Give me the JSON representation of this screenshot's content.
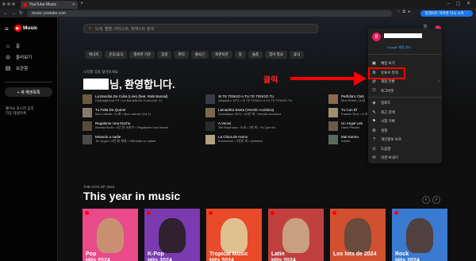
{
  "browser": {
    "tab_title": "YouTube Music",
    "url": "music.youtube.com",
    "update_label": "업데이트 하려면 다시 시작 ⋮",
    "new_tab": "+"
  },
  "app": {
    "brand": "Music",
    "logo_glyph": "▶"
  },
  "sidebar": {
    "items": [
      {
        "icon": "⌂",
        "label": "홈"
      },
      {
        "icon": "◎",
        "label": "둘러보기"
      },
      {
        "icon": "▤",
        "label": "보관함"
      }
    ],
    "new_playlist": "+ 새 재생목록",
    "liked_title": "좋아요 표시한 음악",
    "liked_sub": "자동 재생목록"
  },
  "search": {
    "placeholder": "노래, 앨범, 아티스트, 팟캐스트 검색"
  },
  "chips": [
    "에너지",
    "운동/휴식",
    "행복한 기분",
    "집중",
    "파티",
    "출퇴근",
    "로맨틱한",
    "잠",
    "슬픔",
    "힘이 필요",
    "휴식"
  ],
  "greeting": {
    "small": "시작할 곡을 찾아보세요",
    "suffix": "님, 환영합니다."
  },
  "songs": [
    {
      "title": "La Bandita De Cuba (Live) (feat. Rabi Bansal)",
      "sub": "Charanjit And YS • La Bandita De Cuba (Vol. 1)",
      "color": "#6b5a40"
    },
    {
      "title": "Tu Falta De Querer",
      "sub": "Mon Laferte • 노래 • Mon Laferte (Vol.1)",
      "color": "#8a7a6a"
    },
    {
      "title": "Regalame Una Noche",
      "sub": "Manda Rodri • 4년 전 조회수 • Regalame Una Noche",
      "color": "#5a4a3a"
    },
    {
      "title": "Mirando a nadie",
      "sub": "Ter Argall • 5천 회 재생 • Still state so called",
      "color": "#4a4a4a"
    },
    {
      "title": "SI TE TENGO A TU TE TENGO TU",
      "sub": "Alejandro 1971 • SI TE TENGO A TU TE TENGO TU",
      "color": "#3a3a4a"
    },
    {
      "title": "Lamadrita Santa (Versión Acústica)",
      "sub": "Guadalupe 2021 • 40만 회 • Versión Acústica",
      "color": "#7a6a50"
    },
    {
      "title": "A Veces",
      "sub": "Ziel Espinosa • 노래 • 2천 회 • Yo Que No",
      "color": "#2a2a2a"
    },
    {
      "title": "La Chica de Humo",
      "sub": "Emmanuel • 3천만 회 • Quisiera",
      "color": "#b0a080"
    },
    {
      "title": "Perfidia's Club",
      "sub": "Moz Rebel • 노래",
      "color": "#8a6a4a"
    },
    {
      "title": "Tu Con Él",
      "sub": "Frankie Ruiz • 노래",
      "color": "#a09070"
    },
    {
      "title": "Un Angel Leb",
      "sub": "Hank Piedad",
      "color": "#6a5a4a"
    },
    {
      "title": "Mal Karma",
      "sub": "Adolfo",
      "color": "#5a6a5a"
    }
  ],
  "section": {
    "small": "THE HITS OF 2024",
    "title": "This year in music"
  },
  "cards": [
    {
      "line1": "Pop",
      "line2": "Hits 2024",
      "bg": "#e84a8a",
      "face": "#c89070"
    },
    {
      "line1": "K-Pop",
      "line2": "Hits 2024",
      "bg": "#7a3ab0",
      "face": "#302030"
    },
    {
      "line1": "Tropical Music",
      "line2": "Hits 2024",
      "bg": "#e84a2a",
      "face": "#e0c090"
    },
    {
      "line1": "Latin",
      "line2": "Hits 2024",
      "bg": "#c04040",
      "face": "#c8a080"
    },
    {
      "line1": "Los hits de 2024",
      "line2": "",
      "bg": "#d05030",
      "face": "#6a4a3a"
    },
    {
      "line1": "Rock",
      "line2": "Hits 2024",
      "bg": "#3a7ad0",
      "face": "#504040"
    }
  ],
  "account_menu": {
    "avatar_letter": "B",
    "channel_link": "Google 계정 관리",
    "items": [
      {
        "icon": "▣",
        "label": "채널 보기",
        "chev": ""
      },
      {
        "icon": "⚙",
        "label": "유튜브 뮤직",
        "chev": ""
      },
      {
        "icon": "⇄",
        "label": "계정 전환",
        "chev": "›"
      },
      {
        "icon": "⎋",
        "label": "로그아웃",
        "chev": ""
      },
      {
        "icon": "◈",
        "label": "업로드",
        "chev": ""
      },
      {
        "icon": "✎",
        "label": "최근 검색",
        "chev": ""
      },
      {
        "icon": "⚑",
        "label": "시청 기록",
        "chev": ""
      },
      {
        "icon": "⚙",
        "label": "설정",
        "chev": ""
      },
      {
        "icon": "?",
        "label": "개인정보 보호",
        "chev": ""
      },
      {
        "icon": "⊙",
        "label": "도움말",
        "chev": ""
      },
      {
        "icon": "✉",
        "label": "의견 보내기",
        "chev": ""
      }
    ]
  },
  "annotation": {
    "click_label": "클릭",
    "color": "#ff0000"
  }
}
